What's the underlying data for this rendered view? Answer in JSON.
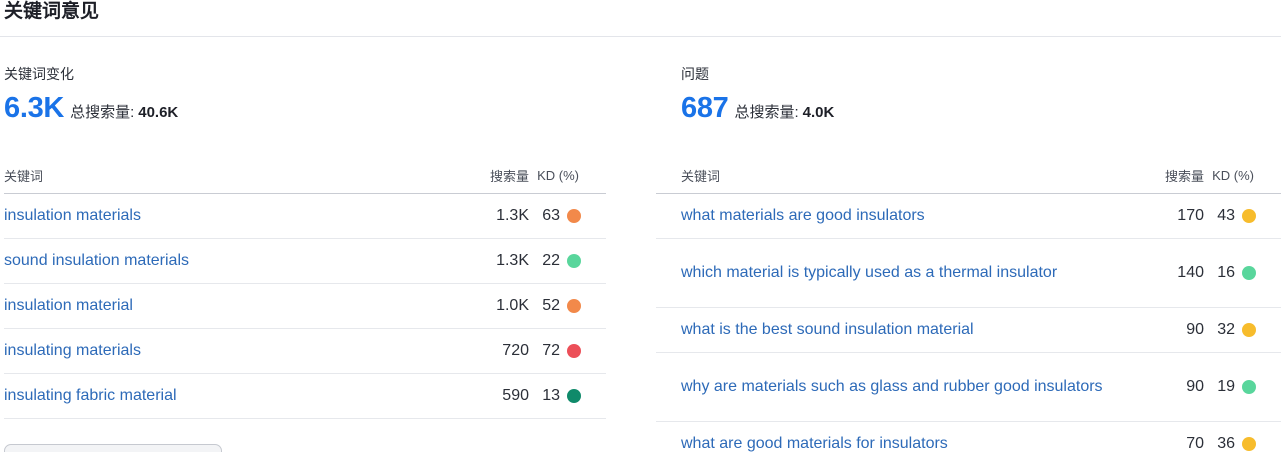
{
  "section_title": "关键词意见",
  "colors": {
    "accent": "#1a73e8",
    "link": "#2d6ab8",
    "kd_orange": "#f2894a",
    "kd_light_green": "#59d69c",
    "kd_red": "#ec4f58",
    "kd_dark_green": "#0f8a6a",
    "kd_yellow": "#f7bc2c"
  },
  "keyword_variations": {
    "label": "关键词变化",
    "count": "6.3K",
    "total_label": "总搜索量:",
    "total_value": "40.6K",
    "headers": {
      "keyword": "关键词",
      "volume": "搜索量",
      "kd": "KD (%)"
    },
    "rows": [
      {
        "keyword": "insulation materials",
        "volume": "1.3K",
        "kd": "63",
        "kd_color": "#f2894a"
      },
      {
        "keyword": "sound insulation materials",
        "volume": "1.3K",
        "kd": "22",
        "kd_color": "#59d69c"
      },
      {
        "keyword": "insulation material",
        "volume": "1.0K",
        "kd": "52",
        "kd_color": "#f2894a"
      },
      {
        "keyword": "insulating materials",
        "volume": "720",
        "kd": "72",
        "kd_color": "#ec4f58"
      },
      {
        "keyword": "insulating fabric material",
        "volume": "590",
        "kd": "13",
        "kd_color": "#0f8a6a"
      }
    ]
  },
  "questions": {
    "label": "问题",
    "count": "687",
    "total_label": "总搜索量:",
    "total_value": "4.0K",
    "headers": {
      "keyword": "关键词",
      "volume": "搜索量",
      "kd": "KD (%)"
    },
    "rows": [
      {
        "keyword": "what materials are good insulators",
        "volume": "170",
        "kd": "43",
        "kd_color": "#f7bc2c"
      },
      {
        "keyword": "which material is typically used as a thermal insulator",
        "volume": "140",
        "kd": "16",
        "kd_color": "#59d69c"
      },
      {
        "keyword": "what is the best sound insulation material",
        "volume": "90",
        "kd": "32",
        "kd_color": "#f7bc2c"
      },
      {
        "keyword": "why are materials such as glass and rubber good insulators",
        "volume": "90",
        "kd": "19",
        "kd_color": "#59d69c"
      },
      {
        "keyword": "what are good materials for insulators",
        "volume": "70",
        "kd": "36",
        "kd_color": "#f7bc2c"
      }
    ]
  }
}
